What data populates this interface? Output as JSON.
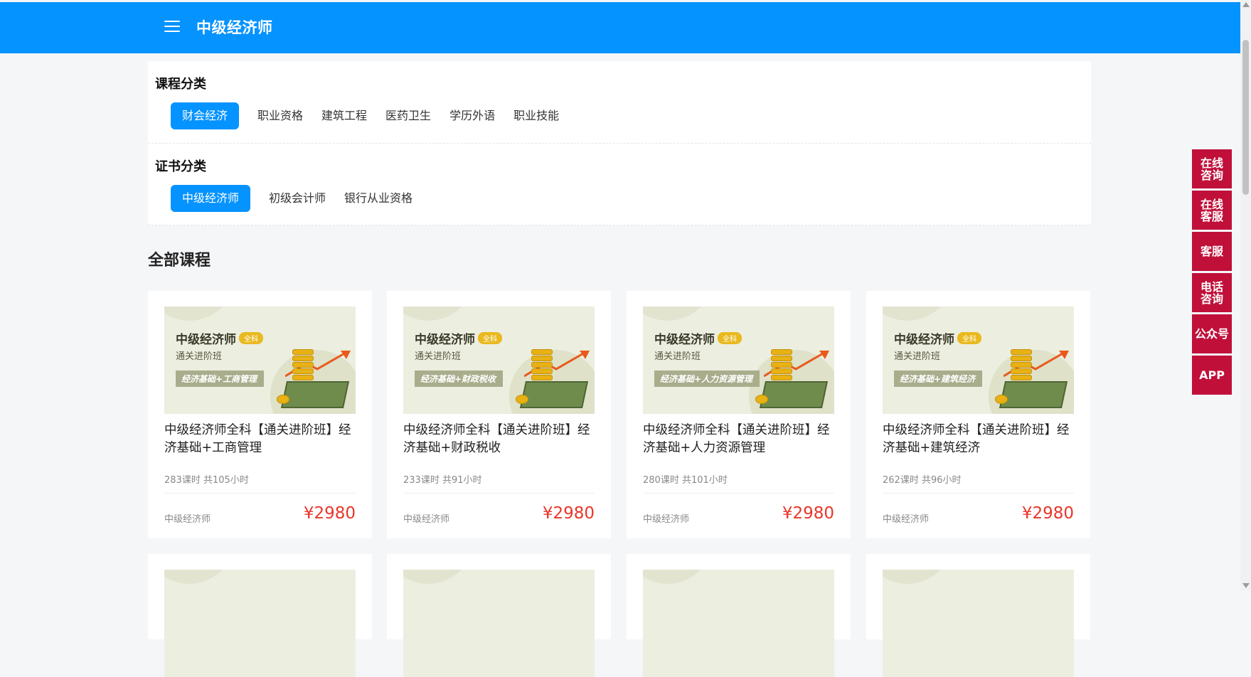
{
  "header": {
    "title": "中级经济师"
  },
  "course_category": {
    "heading": "课程分类",
    "items": [
      "财会经济",
      "职业资格",
      "建筑工程",
      "医药卫生",
      "学历外语",
      "职业技能"
    ],
    "active": 0
  },
  "cert_category": {
    "heading": "证书分类",
    "items": [
      "中级经济师",
      "初级会计师",
      "银行从业资格"
    ],
    "active": 0
  },
  "courses_title": "全部课程",
  "courses": [
    {
      "thumb_title": "中级经济师",
      "thumb_badge": "全科",
      "thumb_sub": "通关进阶班",
      "thumb_tag": "经济基础+工商管理",
      "title": "中级经济师全科【通关进阶班】经济基础+工商管理",
      "meta": "283课时 共105小时",
      "category": "中级经济师",
      "price": "¥2980"
    },
    {
      "thumb_title": "中级经济师",
      "thumb_badge": "全科",
      "thumb_sub": "通关进阶班",
      "thumb_tag": "经济基础+财政税收",
      "title": "中级经济师全科【通关进阶班】经济基础+财政税收",
      "meta": "233课时 共91小时",
      "category": "中级经济师",
      "price": "¥2980"
    },
    {
      "thumb_title": "中级经济师",
      "thumb_badge": "全科",
      "thumb_sub": "通关进阶班",
      "thumb_tag": "经济基础+人力资源管理",
      "title": "中级经济师全科【通关进阶班】经济基础+人力资源管理",
      "meta": "280课时 共101小时",
      "category": "中级经济师",
      "price": "¥2980"
    },
    {
      "thumb_title": "中级经济师",
      "thumb_badge": "全科",
      "thumb_sub": "通关进阶班",
      "thumb_tag": "经济基础+建筑经济",
      "title": "中级经济师全科【通关进阶班】经济基础+建筑经济",
      "meta": "262课时 共96小时",
      "category": "中级经济师",
      "price": "¥2980"
    }
  ],
  "float_bar": [
    "在线\n咨询",
    "在线\n客服",
    "客服",
    "电话\n咨询",
    "公众号",
    "APP"
  ],
  "colors": {
    "header": "#0593ff",
    "chip_active": "#0593ff",
    "price": "#e9362a",
    "float_button": "#c0103a"
  }
}
